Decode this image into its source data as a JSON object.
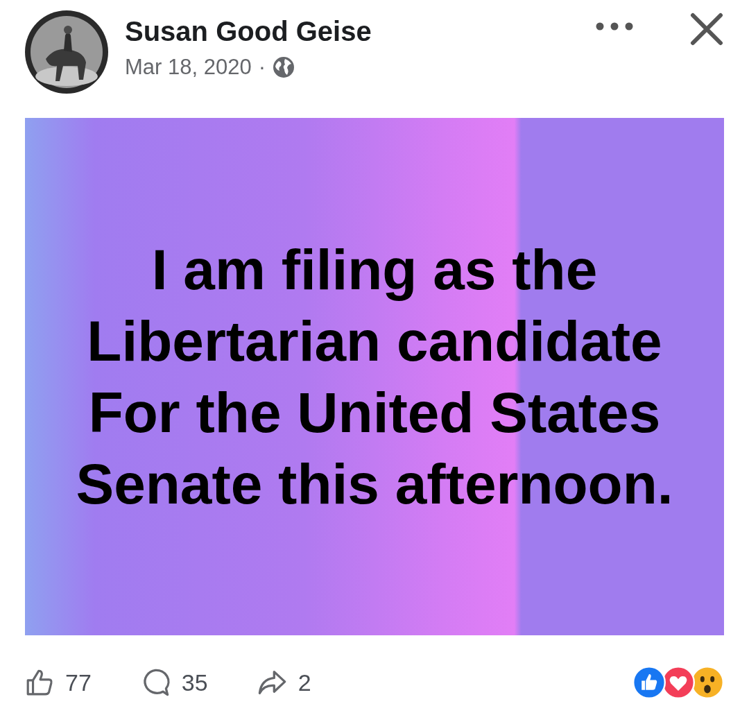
{
  "post": {
    "author": "Susan Good Geise",
    "date": "Mar 18, 2020",
    "separator": "·",
    "text_lines": [
      "I am filing as the",
      "Libertarian candidate",
      "For the United States",
      "Senate this afternoon."
    ]
  },
  "actions": {
    "likes": "77",
    "comments": "35",
    "shares": "2"
  },
  "reactions": [
    {
      "kind": "like"
    },
    {
      "kind": "love"
    },
    {
      "kind": "wow"
    }
  ]
}
